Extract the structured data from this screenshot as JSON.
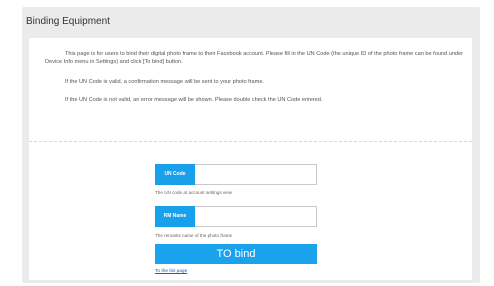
{
  "page": {
    "title": "Binding Equipment"
  },
  "info": {
    "paragraph_1": "This page is for users to bind their digital photo frame to their Facebook account. Please fill in the UN Code (the unique ID of the photo frame can be found under Device Info menu in Settings) and click [To bind] button.",
    "paragraph_2": "If the UN Code is valid, a confirmation message will be sent to your photo frame.",
    "paragraph_3": "If the UN Code is not valid, an error message will be shown. Please double check the UN Code entered."
  },
  "form": {
    "un_code": {
      "label": "UN Code",
      "value": "",
      "hint": "The UN code at account settings view"
    },
    "rm_name": {
      "label": "RM Name",
      "value": "",
      "hint": "The remarks name of the photo frame"
    },
    "bind_button": "TO bind",
    "back_link": "To the list page"
  },
  "colors": {
    "accent": "#19a0ea",
    "panel_background": "#ebebeb",
    "link": "#1a5fb4"
  }
}
